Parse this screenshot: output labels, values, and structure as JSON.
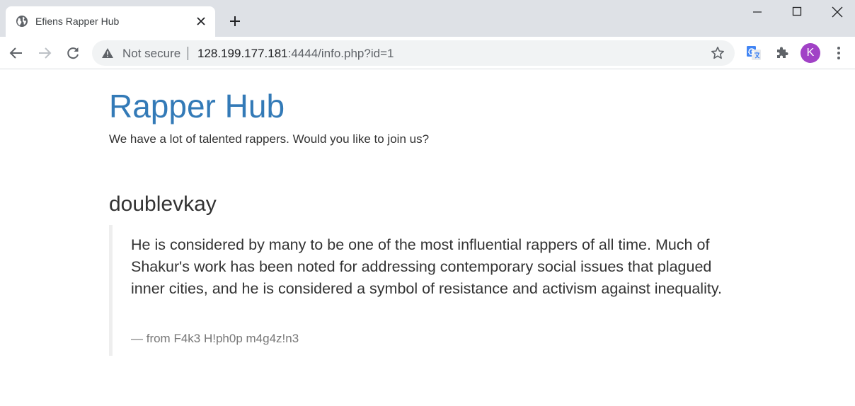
{
  "browser": {
    "tab": {
      "title": "Efiens Rapper Hub"
    },
    "address_bar": {
      "security_label": "Not secure",
      "url_host": "128.199.177.181",
      "url_rest": ":4444/info.php?id=1"
    },
    "profile": {
      "initial": "K",
      "color": "#a142c6"
    }
  },
  "icons": {
    "favicon": "globe-icon",
    "tab_close": "close-icon",
    "new_tab": "plus-icon",
    "back": "arrow-left-icon",
    "forward": "arrow-right-icon",
    "reload": "reload-icon",
    "warning": "warning-icon",
    "bookmark": "star-icon",
    "translate": "google-translate-icon",
    "extensions": "puzzle-icon",
    "menu": "kebab-menu-icon"
  },
  "page": {
    "title": "Rapper Hub",
    "tagline": "We have a lot of talented rappers. Would you like to join us?",
    "rapper": {
      "name": "doublevkay",
      "quote": "He is considered by many to be one of the most influential rappers of all time. Much of Shakur's work has been noted for addressing contemporary social issues that plagued inner cities, and he is considered a symbol of resistance and activism against inequality.",
      "source": "— from F4k3 H!ph0p m4g4z!n3"
    }
  },
  "colors": {
    "link_title": "#337ab7",
    "tab_strip": "#dee1e6",
    "omnibox_bg": "#f1f3f4",
    "quote_border": "#eeeeee"
  }
}
